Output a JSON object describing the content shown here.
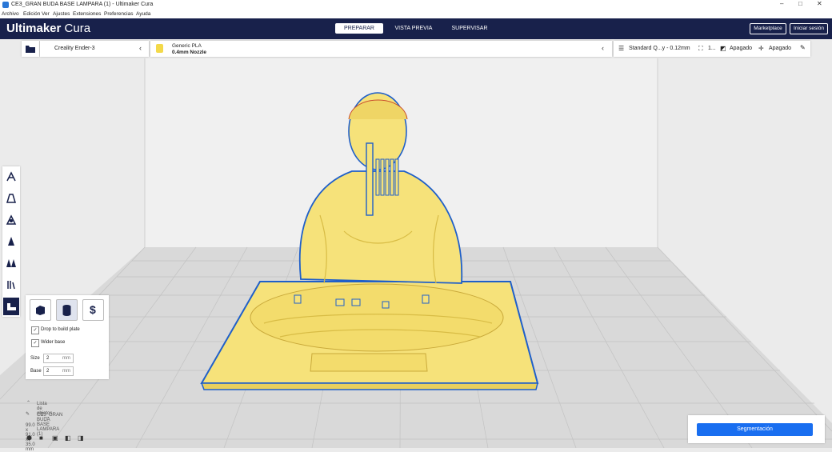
{
  "window": {
    "title": "CE3_GRAN BUDA BASE LAMPARA (1) - Ultimaker Cura",
    "controls": [
      "–",
      "□",
      "✕"
    ]
  },
  "menu": [
    "Archivo",
    "Edición",
    "Ver",
    "Ajustes",
    "Extensiones",
    "Preferencias",
    "Ayuda"
  ],
  "header": {
    "brand_bold": "Ultimaker",
    "brand_light": "Cura",
    "stages": [
      {
        "label": "PREPARAR",
        "active": true
      },
      {
        "label": "VISTA PREVIA",
        "active": false
      },
      {
        "label": "SUPERVISAR",
        "active": false
      }
    ],
    "marketplace_label": "Marketplace",
    "signin_label": "Iniciar sesión"
  },
  "toolbar": {
    "printer_name": "Creality Ender-3",
    "material_name": "Generic PLA",
    "nozzle": "0.4mm Nozzle",
    "profile": "Standard Q...y - 0.12mm",
    "infill": "1...",
    "support": "Apagado",
    "adhesion": "Apagado"
  },
  "tools": [
    {
      "name": "move-icon"
    },
    {
      "name": "scale-icon"
    },
    {
      "name": "rotate-icon"
    },
    {
      "name": "mirror-icon"
    },
    {
      "name": "per-model-settings-icon"
    },
    {
      "name": "support-blocker-icon"
    },
    {
      "name": "tool-plugin-icon",
      "active": true
    }
  ],
  "tool_panel": {
    "buttons": [
      "cube-icon",
      "cylinder-icon",
      "dollar-icon"
    ],
    "drop_label": "Drop to build plate",
    "drop_checked": true,
    "wider_label": "Wider base",
    "wider_checked": true,
    "size_label": "Size",
    "size_value": "2",
    "size_unit": "mm",
    "base_label": "Base",
    "base_value": "2",
    "base_unit": "mm"
  },
  "objects": {
    "list_label": "Lista de objetos",
    "object_name": "CE3_GRAN BUDA BASE LAMPARA (1)",
    "dimensions": "99.0 x 91.0 x 35.0 mm"
  },
  "slice": {
    "button_label": "Segmentación"
  },
  "colors": {
    "header_bg": "#18214b",
    "accent_blue": "#196ef0",
    "model_yellow": "#f6e27a",
    "model_outline": "#1f5fc9"
  }
}
